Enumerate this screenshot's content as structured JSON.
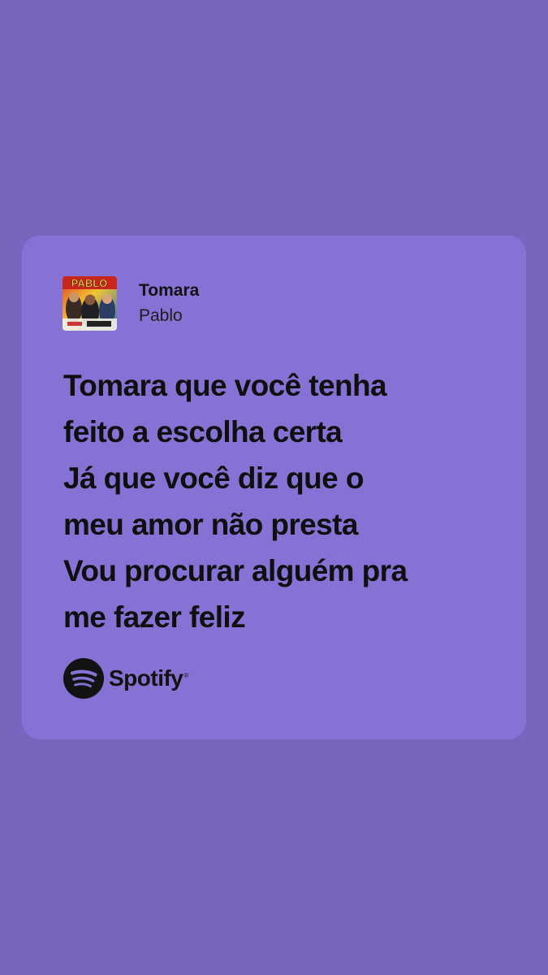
{
  "colors": {
    "background": "#7866be",
    "card": "#8672d4",
    "text": "#121212"
  },
  "track": {
    "title": "Tomara",
    "artist": "Pablo",
    "cover_art_text": "PABLO"
  },
  "lyrics": [
    "Tomara que você tenha",
    "feito a escolha certa",
    "Já que você diz que o",
    "meu amor não presta",
    "Vou procurar alguém pra",
    "me fazer feliz"
  ],
  "brand": {
    "icon": "spotify-icon",
    "name": "Spotify",
    "registered_mark": "®"
  }
}
